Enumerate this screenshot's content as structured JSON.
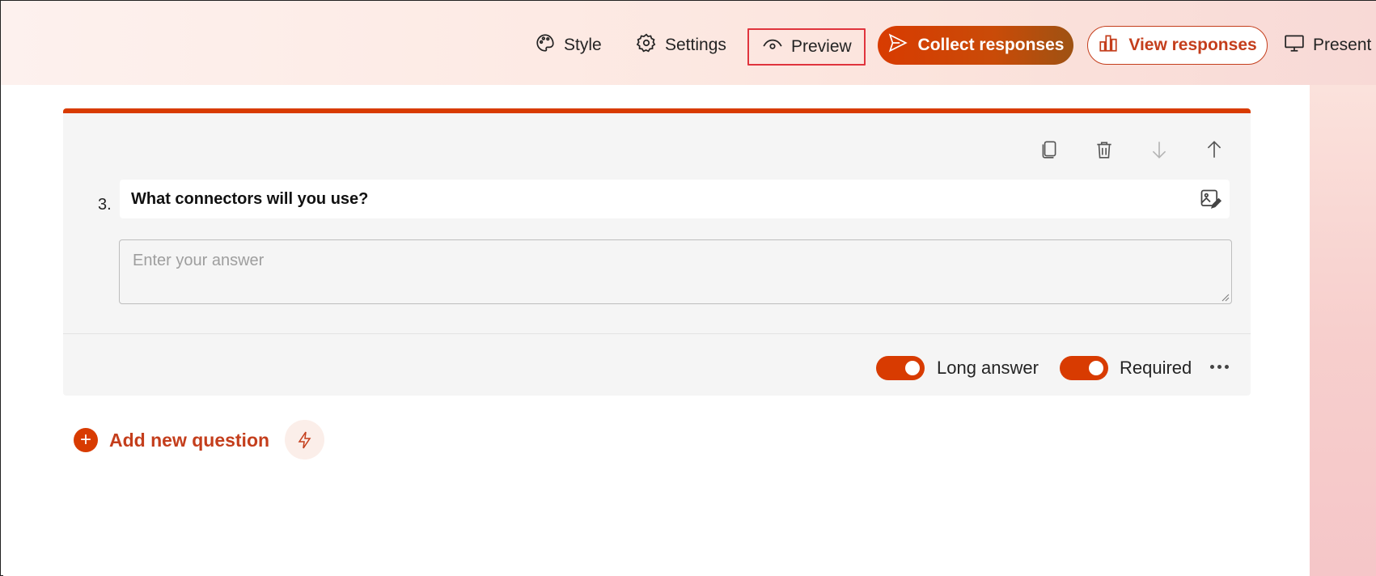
{
  "toolbar": {
    "style_label": "Style",
    "settings_label": "Settings",
    "preview_label": "Preview",
    "collect_label": "Collect responses",
    "view_label": "View responses",
    "present_label": "Present"
  },
  "question": {
    "number": "3.",
    "title": "What connectors will you use?",
    "answer_placeholder": "Enter your answer",
    "long_answer_label": "Long answer",
    "long_answer_on": true,
    "required_label": "Required",
    "required_on": true
  },
  "add_question": {
    "label": "Add new question"
  },
  "colors": {
    "accent": "#d83b01",
    "accent_text": "#c43e1c",
    "highlight_border": "#e0343d"
  },
  "icons": [
    "palette-icon",
    "gear-icon",
    "eye-icon",
    "send-icon",
    "bar-chart-icon",
    "presentation-icon",
    "copy-icon",
    "trash-icon",
    "arrow-down-icon",
    "arrow-up-icon",
    "image-edit-icon",
    "more-icon",
    "plus-icon",
    "lightning-icon"
  ]
}
